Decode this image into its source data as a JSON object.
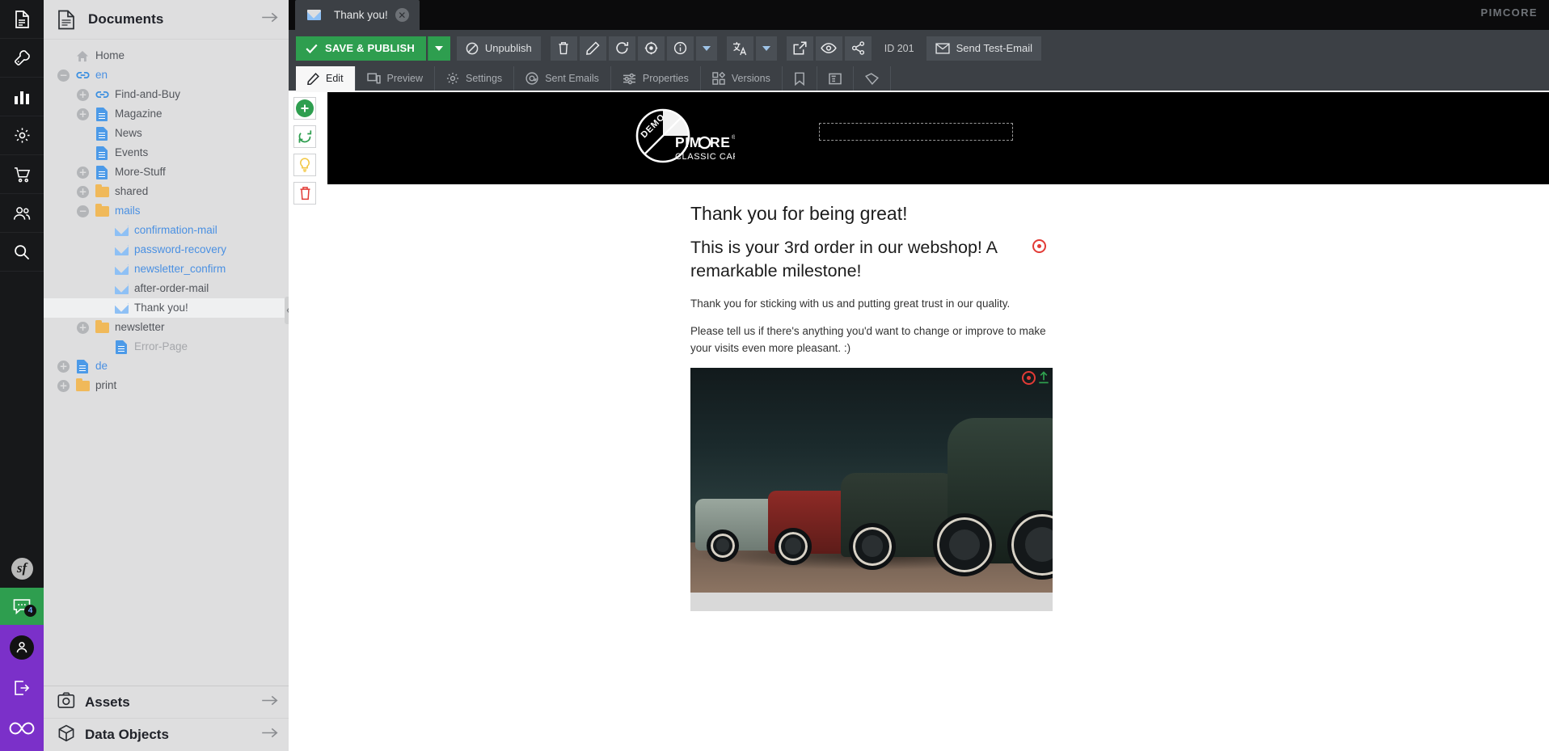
{
  "rail": {
    "items": [
      {
        "name": "documents-icon",
        "label": "Documents"
      },
      {
        "name": "tools-icon",
        "label": "Tools"
      },
      {
        "name": "reports-icon",
        "label": "Reports"
      },
      {
        "name": "settings-icon",
        "label": "Settings"
      },
      {
        "name": "ecommerce-icon",
        "label": "E-Commerce"
      },
      {
        "name": "customers-icon",
        "label": "Customers"
      },
      {
        "name": "search-icon",
        "label": "Search"
      }
    ],
    "symfony_logo": "sf",
    "chat_badge": "4",
    "user_icon": "user-avatar-icon",
    "logout_icon": "logout-icon",
    "infinity_icon": "infinity-logo-icon"
  },
  "documents_panel": {
    "title": "Documents",
    "icon": "document-stack-icon",
    "collapse_arrow": "→",
    "tree": [
      {
        "label": "Home",
        "indent": 0,
        "expander": "none",
        "icon": "home",
        "style": "normal"
      },
      {
        "label": "en",
        "indent": 0,
        "expander": "collapse",
        "icon": "link",
        "style": "link"
      },
      {
        "label": "Find-and-Buy",
        "indent": 1,
        "expander": "expand",
        "icon": "link",
        "style": "normal"
      },
      {
        "label": "Magazine",
        "indent": 1,
        "expander": "expand",
        "icon": "page",
        "style": "normal"
      },
      {
        "label": "News",
        "indent": 1,
        "expander": "none",
        "icon": "page",
        "style": "normal"
      },
      {
        "label": "Events",
        "indent": 1,
        "expander": "none",
        "icon": "page",
        "style": "normal"
      },
      {
        "label": "More-Stuff",
        "indent": 1,
        "expander": "expand",
        "icon": "page",
        "style": "normal"
      },
      {
        "label": "shared",
        "indent": 1,
        "expander": "expand",
        "icon": "folder",
        "style": "normal"
      },
      {
        "label": "mails",
        "indent": 1,
        "expander": "collapse",
        "icon": "folder",
        "style": "link"
      },
      {
        "label": "confirmation-mail",
        "indent": 2,
        "expander": "none",
        "icon": "mail",
        "style": "link"
      },
      {
        "label": "password-recovery",
        "indent": 2,
        "expander": "none",
        "icon": "mail",
        "style": "link"
      },
      {
        "label": "newsletter_confirm",
        "indent": 2,
        "expander": "none",
        "icon": "mail",
        "style": "link"
      },
      {
        "label": "after-order-mail",
        "indent": 2,
        "expander": "none",
        "icon": "mail",
        "style": "normal"
      },
      {
        "label": "Thank you!",
        "indent": 2,
        "expander": "none",
        "icon": "mail",
        "style": "normal",
        "selected": true
      },
      {
        "label": "newsletter",
        "indent": 1,
        "expander": "expand",
        "icon": "folder",
        "style": "normal"
      },
      {
        "label": "Error-Page",
        "indent": 2,
        "expander": "none",
        "icon": "page",
        "style": "muted"
      },
      {
        "label": "de",
        "indent": 0,
        "expander": "expand",
        "icon": "page",
        "style": "link"
      },
      {
        "label": "print",
        "indent": 0,
        "expander": "expand",
        "icon": "folder",
        "style": "normal"
      }
    ],
    "footer": [
      {
        "title": "Assets",
        "icon": "assets-icon",
        "arrow": "→"
      },
      {
        "title": "Data Objects",
        "icon": "data-objects-icon",
        "arrow": "→"
      }
    ]
  },
  "window": {
    "brand": "PIMCORE",
    "tab": {
      "label": "Thank you!",
      "icon": "mail-icon",
      "close": "✕"
    }
  },
  "toolbar": {
    "save_publish": "SAVE & PUBLISH",
    "save_publish_arrow": "▾",
    "unpublish": "Unpublish",
    "id_label": "ID 201",
    "send_test_email": "Send Test-Email",
    "icons": [
      {
        "name": "delete-icon",
        "title": "Delete"
      },
      {
        "name": "rename-icon",
        "title": "Rename"
      },
      {
        "name": "reload-icon",
        "title": "Reload"
      },
      {
        "name": "target-icon",
        "title": "Locate"
      },
      {
        "name": "info-icon",
        "title": "Info"
      },
      {
        "name": "info-dropdown-icon",
        "title": "More"
      },
      {
        "name": "translate-icon",
        "title": "Translate"
      },
      {
        "name": "translate-dropdown-icon",
        "title": "Translate options"
      },
      {
        "name": "open-external-icon",
        "title": "Open"
      },
      {
        "name": "preview-eye-icon",
        "title": "Preview"
      },
      {
        "name": "share-icon",
        "title": "Share"
      }
    ]
  },
  "subtabs": [
    {
      "label": "Edit",
      "icon": "pencil-icon",
      "active": true
    },
    {
      "label": "Preview",
      "icon": "screen-icon",
      "active": false
    },
    {
      "label": "Settings",
      "icon": "gear-icon",
      "active": false
    },
    {
      "label": "Sent Emails",
      "icon": "at-sign-icon",
      "active": false
    },
    {
      "label": "Properties",
      "icon": "sliders-icon",
      "active": false
    },
    {
      "label": "Versions",
      "icon": "blocks-icon",
      "active": false
    },
    {
      "label": "",
      "icon": "bookmark-icon",
      "active": false
    },
    {
      "label": "",
      "icon": "clipboard-icon",
      "active": false
    },
    {
      "label": "",
      "icon": "tag-icon",
      "active": false
    }
  ],
  "edit_rail": [
    {
      "name": "add-element-button",
      "icon": "plus-circle-icon",
      "color": "#2e9e4f"
    },
    {
      "name": "reload-element-button",
      "icon": "refresh-icon",
      "color": "#2e9e4f"
    },
    {
      "name": "hint-button",
      "icon": "lightbulb-icon",
      "color": "#f2c744"
    },
    {
      "name": "delete-element-button",
      "icon": "trash-icon",
      "color": "#e23b36"
    }
  ],
  "email": {
    "logo_demo": "DEMO",
    "logo_main": "PIMCORE",
    "logo_sub": "CLASSIC CARS",
    "heading1": "Thank you for being great!",
    "heading2": "This is your 3rd order in our webshop! A remarkable milestone!",
    "paragraph1": "Thank you for sticking with us and putting great trust in our quality.",
    "paragraph2": "Please tell us if there's anything you'd want to change or improve to make your visits even more pleasant. :)",
    "image_alt": "Vintage classic cars lined up"
  }
}
